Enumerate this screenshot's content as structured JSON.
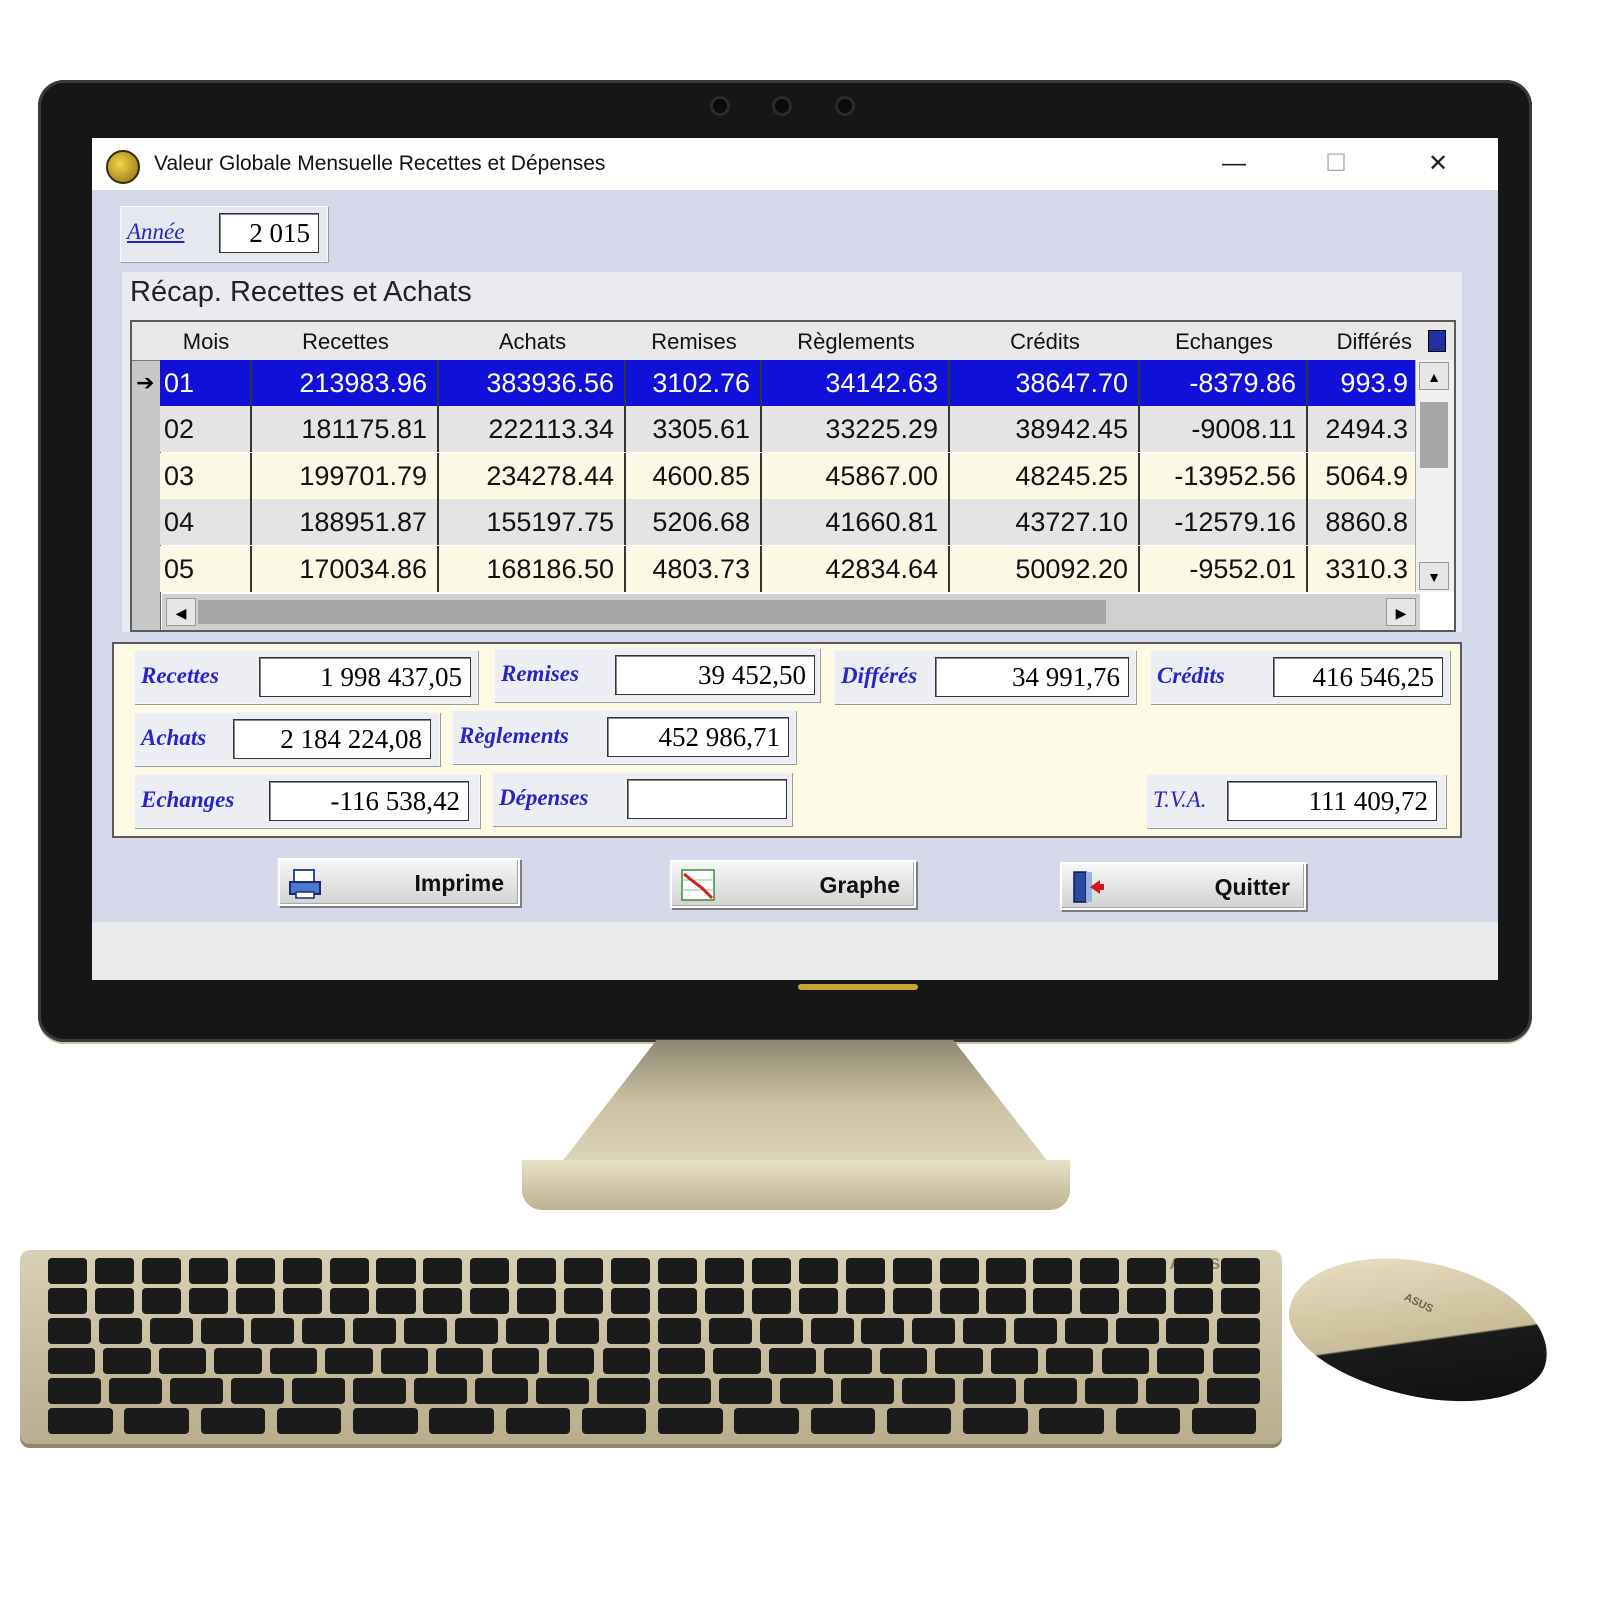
{
  "window": {
    "title": "Valeur Globale Mensuelle Recettes et Dépenses",
    "minimize": "—",
    "maximize": "☐",
    "close": "✕"
  },
  "year": {
    "label": "Année",
    "value": "2 015"
  },
  "grid": {
    "title": "Récap. Recettes et  Achats",
    "columns": [
      "Mois",
      "Recettes",
      "Achats",
      "Remises",
      "Règlements",
      "Crédits",
      "Echanges",
      "Différés"
    ],
    "rows": [
      [
        "01",
        "213983.96",
        "383936.56",
        "3102.76",
        "34142.63",
        "38647.70",
        "-8379.86",
        "993.9"
      ],
      [
        "02",
        "181175.81",
        "222113.34",
        "3305.61",
        "33225.29",
        "38942.45",
        "-9008.11",
        "2494.3"
      ],
      [
        "03",
        "199701.79",
        "234278.44",
        "4600.85",
        "45867.00",
        "48245.25",
        "-13952.56",
        "5064.9"
      ],
      [
        "04",
        "188951.87",
        "155197.75",
        "5206.68",
        "41660.81",
        "43727.10",
        "-12579.16",
        "8860.8"
      ],
      [
        "05",
        "170034.86",
        "168186.50",
        "4803.73",
        "42834.64",
        "50092.20",
        "-9552.01",
        "3310.3"
      ]
    ],
    "selected_row": 0,
    "row_pointer": "➔"
  },
  "totals": {
    "recettes": {
      "label": "Recettes",
      "value": "1 998 437,05"
    },
    "remises": {
      "label": "Remises",
      "value": "39 452,50"
    },
    "differes": {
      "label": "Différés",
      "value": "34 991,76"
    },
    "credits": {
      "label": "Crédits",
      "value": "416 546,25"
    },
    "achats": {
      "label": "Achats",
      "value": "2 184 224,08"
    },
    "reglements": {
      "label": "Règlements",
      "value": "452 986,71"
    },
    "echanges": {
      "label": "Echanges",
      "value": "-116 538,42"
    },
    "depenses": {
      "label": "Dépenses",
      "value": ""
    },
    "tva": {
      "label": "T.V.A.",
      "value": "111 409,72"
    }
  },
  "buttons": {
    "imprime": "Imprime",
    "graphe": "Graphe",
    "quitter": "Quitter"
  },
  "hardware": {
    "keyboard_brand": "ASUS",
    "mouse_brand": "ASUS"
  },
  "colors": {
    "selection": "#1010d8",
    "label_blue": "#2727c8",
    "window_bg": "#d4d8e8"
  }
}
